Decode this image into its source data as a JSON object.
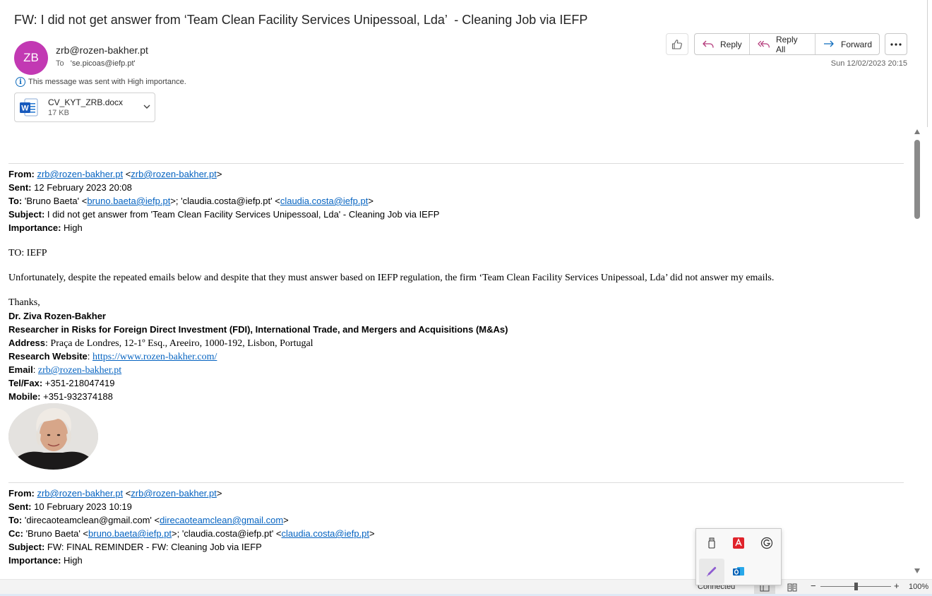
{
  "message": {
    "subject": "FW: I did not get answer from ‘Team Clean Facility Services Unipessoal, Lda’  - Cleaning Job via IEFP",
    "sender_initials": "ZB",
    "sender": "zrb@rozen-bakher.pt",
    "to_label": "To",
    "to_value": "'se.picoas@iefp.pt'",
    "importance_notice": "This message was sent with High importance.",
    "timestamp": "Sun 12/02/2023 20:15",
    "attachment": {
      "name": "CV_KYT_ZRB.docx",
      "size": "17 KB"
    },
    "avatar_color": "#c239b3"
  },
  "actions": {
    "reply": "Reply",
    "reply_all": "Reply All",
    "forward": "Forward"
  },
  "forward1": {
    "from_label": "From:",
    "from_link": "zrb@rozen-bakher.pt",
    "from_lt": "<",
    "from_link2": "zrb@rozen-bakher.pt",
    "from_gt": ">",
    "sent_label": "Sent:",
    "sent_value": "12 February 2023 20:08",
    "to_label": "To:",
    "to_pre": "'Bruno Baeta' <",
    "to_link1": "bruno.baeta@iefp.pt",
    "to_mid": ">; 'claudia.costa@iefp.pt' <",
    "to_link2": "claudia.costa@iefp.pt",
    "to_end": ">",
    "subject_label": "Subject:",
    "subject_value": "I did not get answer from 'Team Clean Facility Services Unipessoal, Lda' - Cleaning Job via IEFP",
    "importance_label": "Importance:",
    "importance_value": "High",
    "greeting": "TO: IEFP",
    "paragraph": "Unfortunately, despite the repeated emails below and despite that they must answer based on IEFP regulation, the firm ‘Team Clean Facility Services Unipessoal, Lda’ did not answer my emails.",
    "thanks": "Thanks,"
  },
  "signature": {
    "name": "Dr. Ziva Rozen-Bakher",
    "title": "Researcher in Risks for Foreign Direct Investment (FDI), International Trade, and Mergers and Acquisitions (M&As)",
    "address_label": "Address",
    "address_value": ": Praça de Londres, 12-1º Esq., Areeiro, 1000-192, Lisbon, Portugal",
    "website_label": "Research Website",
    "website_sep": ": ",
    "website_link": "https://www.rozen-bakher.com/",
    "email_label": "Email",
    "email_sep": ": ",
    "email_link": "zrb@rozen-bakher.pt",
    "tel_label": "Tel/Fax:",
    "tel_value": " +351-218047419",
    "mobile_label": "Mobile:",
    "mobile_value": " +351-932374188"
  },
  "forward2": {
    "from_label": "From:",
    "from_link": "zrb@rozen-bakher.pt",
    "from_lt": "<",
    "from_link2": "zrb@rozen-bakher.pt",
    "from_gt": ">",
    "sent_label": "Sent:",
    "sent_value": "10 February 2023 10:19",
    "to_label": "To:",
    "to_pre": "'direcaoteamclean@gmail.com' <",
    "to_link": "direcaoteamclean@gmail.com",
    "to_end": ">",
    "cc_label": "Cc:",
    "cc_pre": "'Bruno Baeta' <",
    "cc_link1": "bruno.baeta@iefp.pt",
    "cc_mid": ">; 'claudia.costa@iefp.pt' <",
    "cc_link2": "claudia.costa@iefp.pt",
    "cc_end": ">",
    "subject_label": "Subject:",
    "subject_value": "FW: FINAL REMINDER - FW: Cleaning Job via IEFP",
    "importance_label": "Importance:",
    "importance_value": "High"
  },
  "statusbar": {
    "connection": "Connected",
    "zoom_minus": "−",
    "zoom_plus": "+",
    "zoom": "100%",
    "zoom_level": 0.5
  },
  "tray_icons": [
    "usb-drive-icon",
    "adobe-acrobat-icon",
    "grammarly-icon",
    "pen-icon",
    "outlook-icon"
  ]
}
